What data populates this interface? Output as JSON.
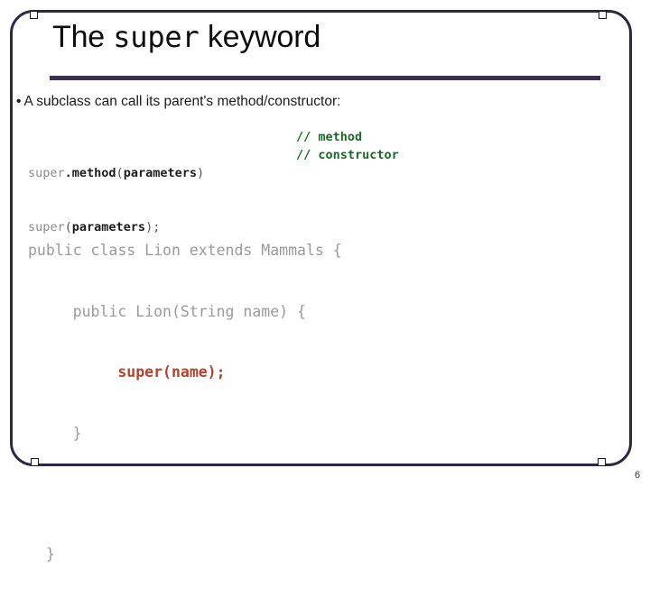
{
  "slide": {
    "title": {
      "prefix": "The ",
      "keyword": "super",
      "suffix": " keyword"
    },
    "bullet": {
      "marker": "•",
      "text": "A subclass can call its parent's method/constructor:"
    },
    "signature_block": {
      "line1": {
        "keyword": "super",
        "call": ".method",
        "open": "(",
        "args": "parameters",
        "close": ")",
        "comment": "// method"
      },
      "line2": {
        "keyword": "super",
        "open": "(",
        "args": "parameters",
        "close": ")",
        "semicolon": ";",
        "comment": "// constructor"
      }
    },
    "example_block": {
      "line1": "public class Lion extends Mammals {",
      "line2": "     public Lion(String name) {",
      "line3_indent": "          ",
      "line3_highlight": "super(name);",
      "line4": "     }",
      "line5": "  }"
    },
    "page_number": "6",
    "colors": {
      "frame": "#2e2642",
      "rule": "#3a2f4f",
      "comment_green": "#166b22",
      "highlight_red": "#b3422f",
      "code_gray": "#9a9a9a",
      "text_black": "#1a1a1a",
      "background": "#ffffff"
    }
  }
}
